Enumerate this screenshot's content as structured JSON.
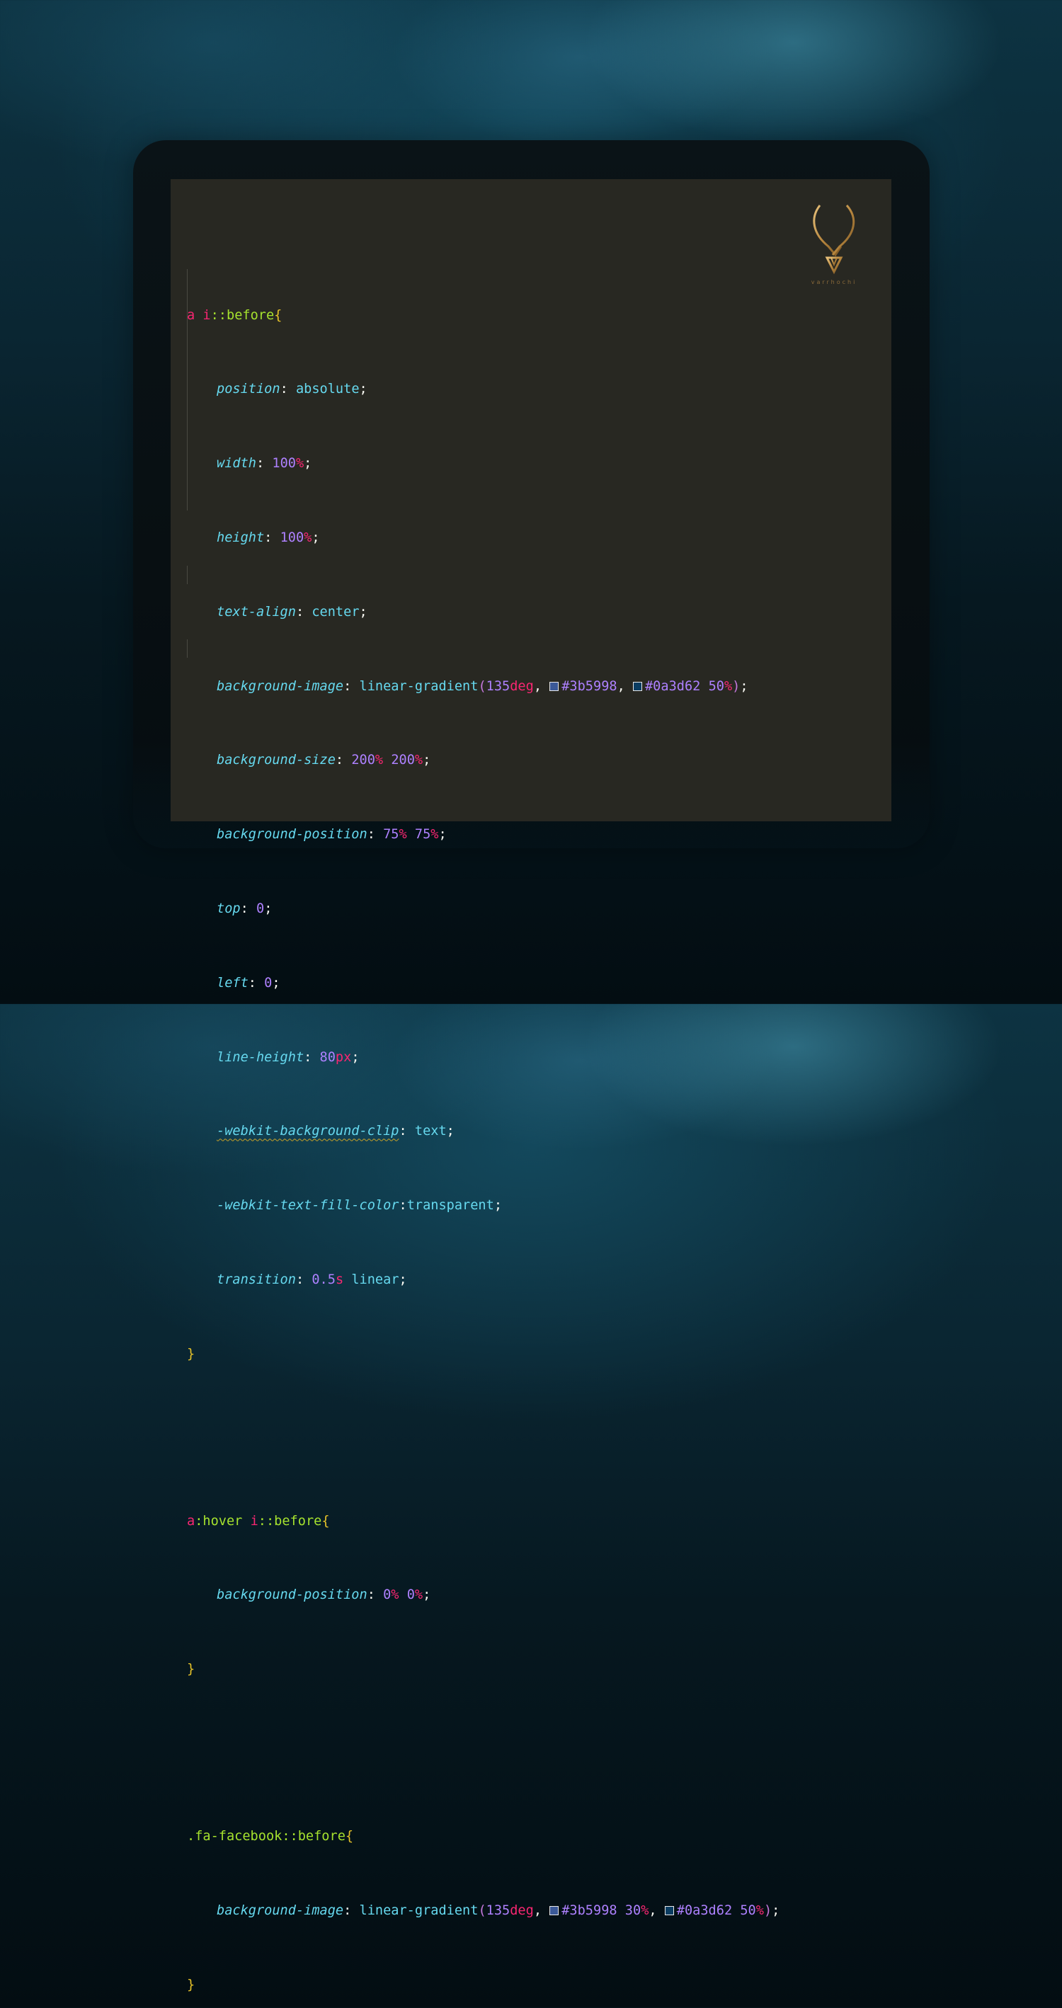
{
  "colors": {
    "swatch_1": "#3b5998",
    "swatch_2": "#0a3d62",
    "logo_gold": "#c99a4a"
  },
  "logo": {
    "icon": "horned-v-logo-icon",
    "text": "varrhochi"
  },
  "code": {
    "block1": {
      "selector_tag": "a",
      "selector_rest": "i::before",
      "open": "{",
      "close": "}",
      "lines": [
        {
          "prop": "position",
          "val": "absolute"
        },
        {
          "prop": "width",
          "num": "100",
          "unit": "%"
        },
        {
          "prop": "height",
          "num": "100",
          "unit": "%"
        },
        {
          "prop": "text-align",
          "val": "center"
        },
        {
          "prop": "background-image",
          "fn": "linear-gradient",
          "deg_num": "135",
          "deg_unit": "deg",
          "c1": "#3b5998",
          "c2": "#0a3d62",
          "c2_num": "50",
          "c2_unit": "%"
        },
        {
          "prop": "background-size",
          "n1": "200",
          "n2": "200",
          "unit": "%"
        },
        {
          "prop": "background-position",
          "n1": "75",
          "n2": "75",
          "unit": "%"
        },
        {
          "prop": "top",
          "num": "0"
        },
        {
          "prop": "left",
          "num": "0"
        },
        {
          "prop": "line-height",
          "num": "80",
          "unit": "px"
        },
        {
          "prop": "-webkit-background-clip",
          "val": "text"
        },
        {
          "prop": "-webkit-text-fill-color",
          "val": "transparent"
        },
        {
          "prop": "transition",
          "num": "0.5",
          "unit": "s",
          "val": "linear"
        }
      ]
    },
    "block2": {
      "selector_tag": "a",
      "selector_pseudo": ":hover",
      "selector_rest": "i::before",
      "open": "{",
      "close": "}",
      "line": {
        "prop": "background-position",
        "n1": "0",
        "n2": "0",
        "unit": "%"
      }
    },
    "block3": {
      "selector_class": ".fa-facebook::before",
      "open": "{",
      "close": "}",
      "line": {
        "prop": "background-image",
        "fn": "linear-gradient",
        "deg_num": "135",
        "deg_unit": "deg",
        "c1": "#3b5998",
        "c1_num": "30",
        "c2": "#0a3d62",
        "c2_num": "50",
        "unit": "%"
      }
    }
  }
}
